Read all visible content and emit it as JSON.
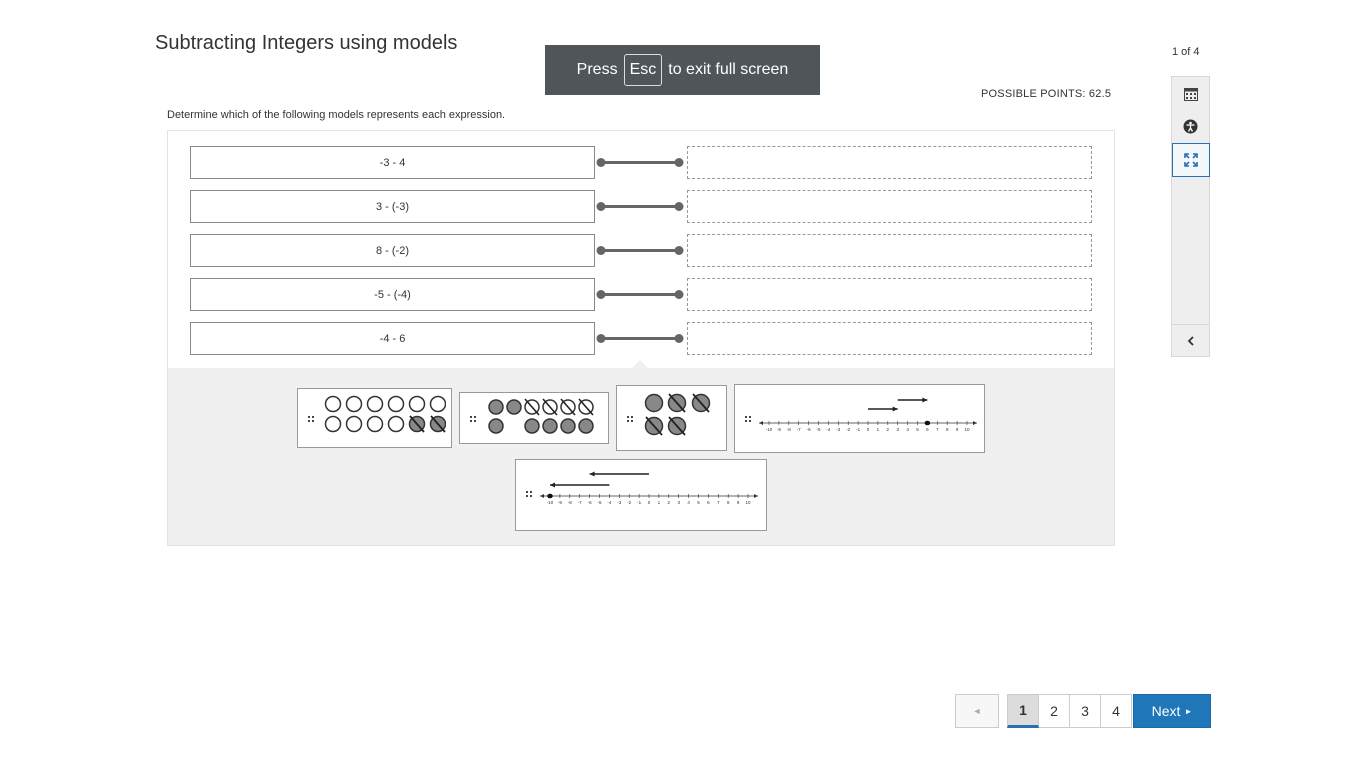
{
  "page": {
    "title": "Subtracting Integers using models",
    "counter": "1 of 4",
    "points_label": "POSSIBLE POINTS: 62.5",
    "instructions": "Determine which of the following models represents each expression."
  },
  "fullscreen_banner": {
    "before": "Press",
    "key": "Esc",
    "after": "to exit full screen"
  },
  "tools": [
    {
      "name": "calculator-icon"
    },
    {
      "name": "accessibility-icon"
    },
    {
      "name": "fullscreen-icon",
      "active": true
    },
    {
      "name": "chevron-left-icon"
    }
  ],
  "expressions": [
    "-3 - 4",
    "3 - (-3)",
    "8 - (-2)",
    "-5 - (-4)",
    "-4 - 6"
  ],
  "models": [
    {
      "type": "counters",
      "description": "12 white counters, 2 crossed out"
    },
    {
      "type": "counters",
      "description": "8 gray counters, 4 white counters crossed out"
    },
    {
      "type": "counters",
      "description": "5 gray counters, 4 crossed out"
    },
    {
      "type": "number-line",
      "range": [
        -10,
        10
      ],
      "end": 6,
      "arrows": "right"
    },
    {
      "type": "number-line",
      "range": [
        -10,
        10
      ],
      "end": -10,
      "arrows": "left"
    }
  ],
  "number_line_ticks": [
    "-10",
    "-9",
    "-8",
    "-7",
    "-6",
    "-5",
    "-4",
    "-3",
    "-2",
    "-1",
    "0",
    "1",
    "2",
    "3",
    "4",
    "5",
    "6",
    "7",
    "8",
    "9",
    "10"
  ],
  "pagination": {
    "prev": "◄",
    "pages": [
      "1",
      "2",
      "3",
      "4"
    ],
    "current": "1",
    "next_label": "Next",
    "next_arrow": "►"
  },
  "colors": {
    "accent": "#1f77b9",
    "banner": "#50555a",
    "counter_gray": "#888888",
    "pool_bg": "#f0f0f0"
  }
}
